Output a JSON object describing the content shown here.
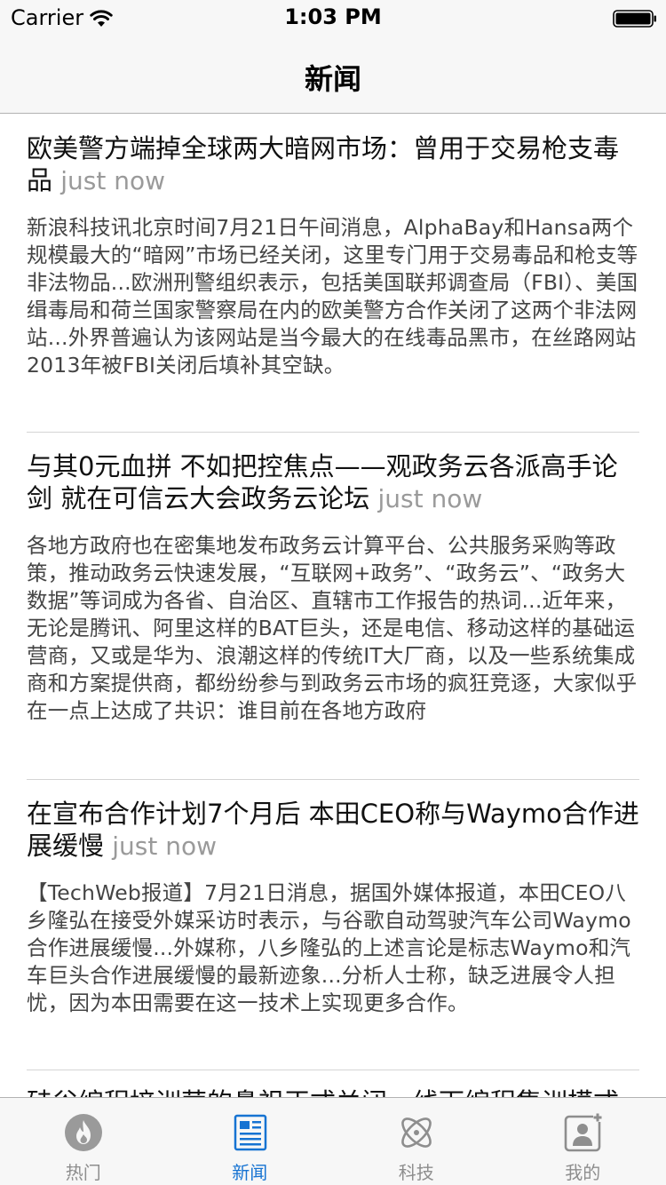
{
  "status_bar": {
    "carrier": "Carrier",
    "time": "1:03 PM"
  },
  "nav": {
    "title": "新闻"
  },
  "news": [
    {
      "title": "欧美警方端掉全球两大暗网市场：曾用于交易枪支毒品",
      "time": "just now",
      "desc": "新浪科技讯北京时间7月21日午间消息，AlphaBay和Hansa两个规模最大的“暗网”市场已经关闭，这里专门用于交易毒品和枪支等非法物品...欧洲刑警组织表示，包括美国联邦调查局（FBI）、美国缉毒局和荷兰国家警察局在内的欧美警方合作关闭了这两个非法网站...外界普遍认为该网站是当今最大的在线毒品黑市，在丝路网站2013年被FBI关闭后填补其空缺。"
    },
    {
      "title": "与其0元血拼 不如把控焦点——观政务云各派高手论剑 就在可信云大会政务云论坛",
      "time": "just now",
      "desc": "各地方政府也在密集地发布政务云计算平台、公共服务采购等政策，推动政务云快速发展，“互联网+政务”、“政务云”、“政务大数据”等词成为各省、自治区、直辖市工作报告的热词...近年来，无论是腾讯、阿里这样的BAT巨头，还是电信、移动这样的基础运营商，又或是华为、浪潮这样的传统IT大厂商，以及一些系统集成商和方案提供商，都纷纷参与到政务云市场的疯狂竞逐，大家似乎在一点上达成了共识：谁目前在各地方政府"
    },
    {
      "title": "在宣布合作计划7个月后 本田CEO称与Waymo合作进展缓慢",
      "time": "just now",
      "desc": "【TechWeb报道】7月21日消息，据国外媒体报道，本田CEO八乡隆弘在接受外媒采访时表示，与谷歌自动驾驶汽车公司Waymo合作进展缓慢...外媒称，八乡隆弘的上述言论是标志Waymo和汽车巨头合作进展缓慢的最新迹象...分析人士称，缺乏进展令人担忧，因为本田需要在这一技术上实现更多合作。"
    },
    {
      "title": "硅谷编程培训营的鼻祖正式关闭，线下编程集训模式"
    }
  ],
  "tabs": [
    {
      "label": "热门",
      "icon": "flame-icon",
      "active": false
    },
    {
      "label": "新闻",
      "icon": "newspaper-icon",
      "active": true
    },
    {
      "label": "科技",
      "icon": "atom-icon",
      "active": false
    },
    {
      "label": "我的",
      "icon": "profile-icon",
      "active": false
    }
  ],
  "colors": {
    "accent": "#1673d2",
    "inactive": "#8e8e8e",
    "bar_bg": "#f7f7f7",
    "time_gray": "#9a9a9a"
  }
}
